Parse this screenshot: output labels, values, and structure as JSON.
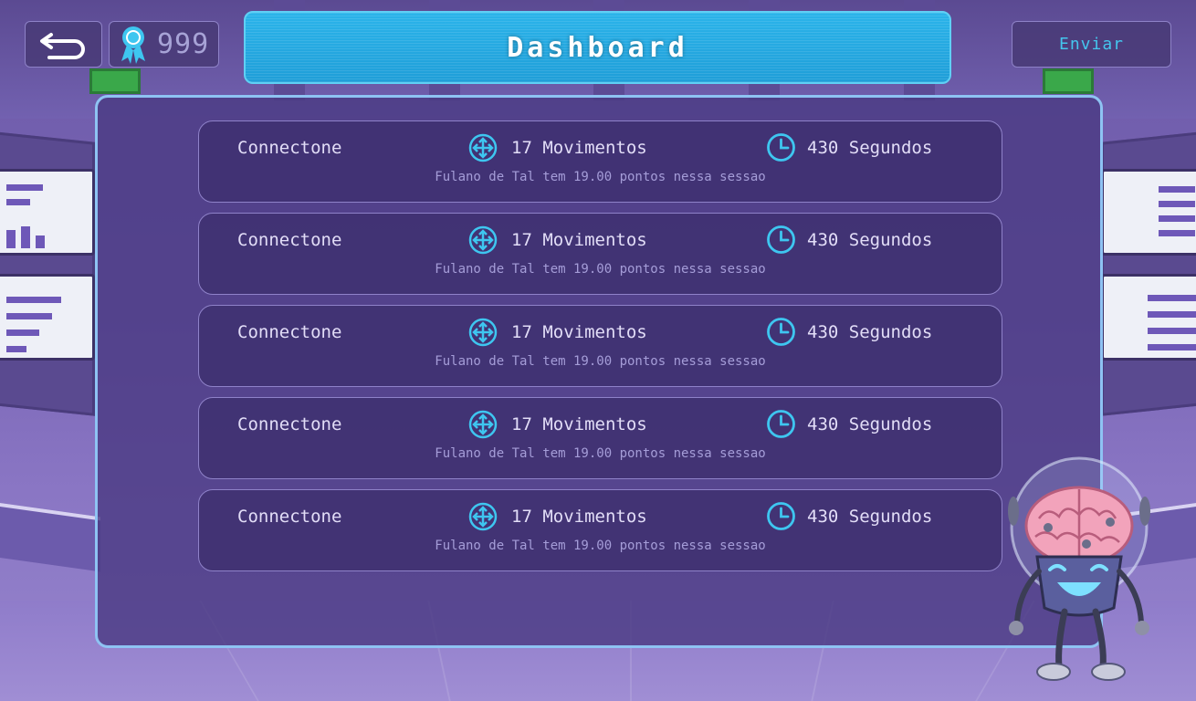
{
  "header": {
    "back_icon": "back-arrow-icon",
    "badge_icon": "award-ribbon-icon",
    "points": "999",
    "title": "Dashboard",
    "send_label": "Enviar"
  },
  "colors": {
    "accent_cyan": "#44c6ee",
    "banner_blue": "#1f9ed8",
    "panel_border": "#8ec3f3"
  },
  "sessions": [
    {
      "game": "Connectone",
      "moves": "17 Movimentos",
      "time": "430 Segundos",
      "summary": "Fulano de Tal tem 19.00 pontos nessa sessao"
    },
    {
      "game": "Connectone",
      "moves": "17 Movimentos",
      "time": "430 Segundos",
      "summary": "Fulano de Tal tem 19.00 pontos nessa sessao"
    },
    {
      "game": "Connectone",
      "moves": "17 Movimentos",
      "time": "430 Segundos",
      "summary": "Fulano de Tal tem 19.00 pontos nessa sessao"
    },
    {
      "game": "Connectone",
      "moves": "17 Movimentos",
      "time": "430 Segundos",
      "summary": "Fulano de Tal tem 19.00 pontos nessa sessao"
    },
    {
      "game": "Connectone",
      "moves": "17 Movimentos",
      "time": "430 Segundos",
      "summary": "Fulano de Tal tem 19.00 pontos nessa sessao"
    }
  ],
  "icons": {
    "moves": "move-arrows-icon",
    "time": "clock-icon",
    "mascot": "brain-robot-mascot"
  }
}
